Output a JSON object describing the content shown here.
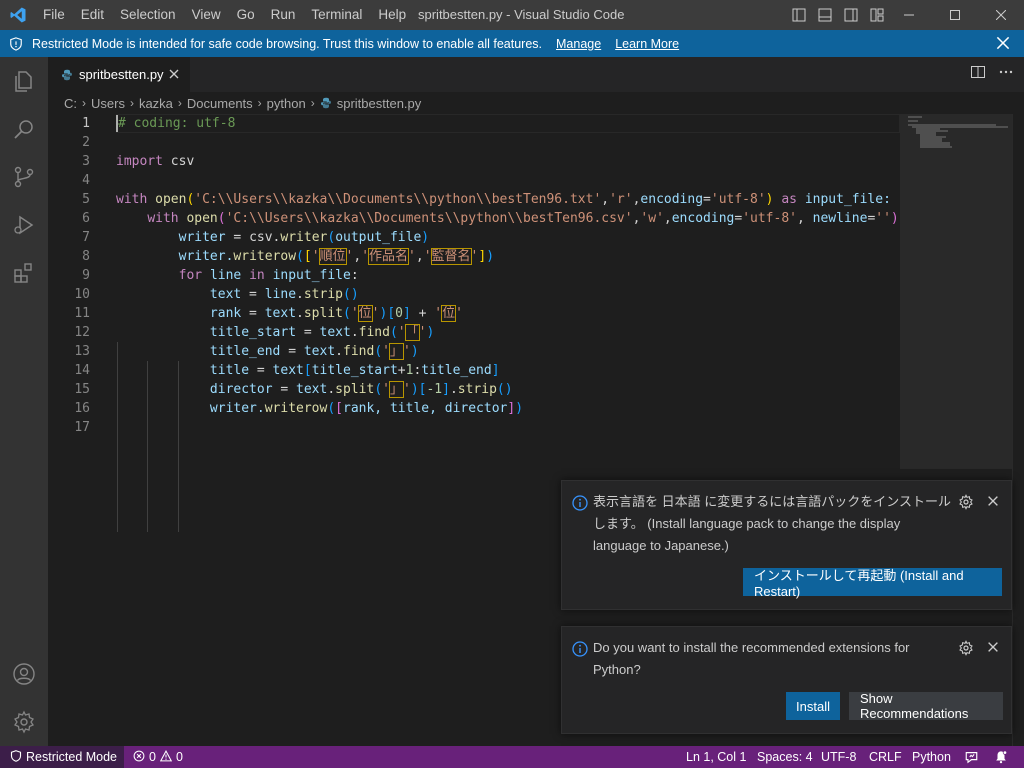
{
  "titlebar": {
    "menu": [
      "File",
      "Edit",
      "Selection",
      "View",
      "Go",
      "Run",
      "Terminal",
      "Help"
    ],
    "window_title": "spritbestten.py - Visual Studio Code"
  },
  "banner": {
    "text": "Restricted Mode is intended for safe code browsing. Trust this window to enable all features.",
    "manage": "Manage",
    "learn_more": "Learn More"
  },
  "tab": {
    "filename": "spritbestten.py"
  },
  "breadcrumb": [
    "C:",
    "Users",
    "kazka",
    "Documents",
    "python",
    "spritbestten.py"
  ],
  "editor": {
    "line_numbers": [
      "1",
      "2",
      "3",
      "4",
      "5",
      "6",
      "7",
      "8",
      "9",
      "10",
      "11",
      "12",
      "13",
      "14",
      "15",
      "16",
      "17"
    ],
    "active_line": 1
  },
  "notifications": [
    {
      "message": "表示言語を 日本語 に変更するには言語パックをインストールします。 (Install language pack to change the display language to Japanese.)",
      "primary_button": "インストールして再起動 (Install and Restart)"
    },
    {
      "message": "Do you want to install the recommended extensions for Python?",
      "primary_button": "Install",
      "secondary_button": "Show Recommendations"
    }
  ],
  "statusbar": {
    "restricted": "Restricted Mode",
    "errors": "0",
    "warnings": "0",
    "position": "Ln 1, Col 1",
    "spaces": "Spaces: 4",
    "encoding": "UTF-8",
    "eol": "CRLF",
    "language": "Python"
  },
  "colors": {
    "accent": "#0e639c",
    "statusbar": "#68217a",
    "restricted_bg": "#3c1e49"
  }
}
